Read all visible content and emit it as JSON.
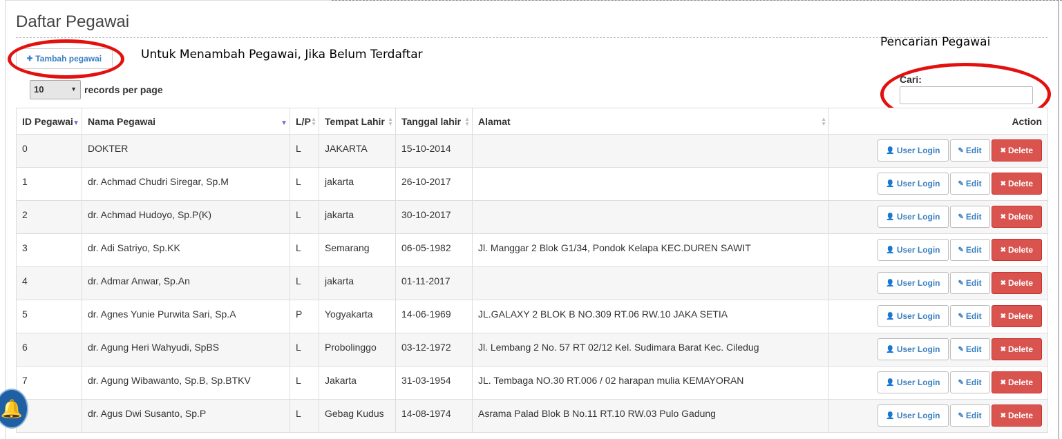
{
  "page": {
    "title": "Daftar Pegawai"
  },
  "toolbar": {
    "add_label": "Tambah pegawai",
    "add_icon": "plus-icon"
  },
  "annotations": {
    "add_note": "Untuk Menambah Pegawai, Jika Belum Terdaftar",
    "search_note": "Pencarian Pegawai",
    "highlight_color": "#e3110e"
  },
  "length_menu": {
    "value": "10",
    "label": "records per page"
  },
  "search": {
    "label": "Cari:",
    "value": ""
  },
  "table": {
    "headers": [
      "ID Pegawai",
      "Nama Pegawai",
      "L/P",
      "Tempat Lahir",
      "Tanggal lahir",
      "Alamat",
      "Action"
    ],
    "sorted_column": "Nama Pegawai",
    "rows": [
      {
        "id": "0",
        "name": "DOKTER",
        "gender": "L",
        "birthplace": "JAKARTA",
        "birthdate": "15-10-2014",
        "address": ""
      },
      {
        "id": "1",
        "name": "dr. Achmad Chudri Siregar, Sp.M",
        "gender": "L",
        "birthplace": "jakarta",
        "birthdate": "26-10-2017",
        "address": ""
      },
      {
        "id": "2",
        "name": "dr. Achmad Hudoyo, Sp.P(K)",
        "gender": "L",
        "birthplace": "jakarta",
        "birthdate": "30-10-2017",
        "address": ""
      },
      {
        "id": "3",
        "name": "dr. Adi Satriyo, Sp.KK",
        "gender": "L",
        "birthplace": "Semarang",
        "birthdate": "06-05-1982",
        "address": "Jl. Manggar 2 Blok G1/34, Pondok Kelapa KEC.DUREN SAWIT"
      },
      {
        "id": "4",
        "name": "dr. Admar Anwar, Sp.An",
        "gender": "L",
        "birthplace": "jakarta",
        "birthdate": "01-11-2017",
        "address": ""
      },
      {
        "id": "5",
        "name": "dr. Agnes Yunie Purwita Sari, Sp.A",
        "gender": "P",
        "birthplace": "Yogyakarta",
        "birthdate": "14-06-1969",
        "address": "JL.GALAXY 2 BLOK B NO.309 RT.06 RW.10 JAKA SETIA"
      },
      {
        "id": "6",
        "name": "dr. Agung Heri Wahyudi, SpBS",
        "gender": "L",
        "birthplace": "Probolinggo",
        "birthdate": "03-12-1972",
        "address": "Jl. Lembang 2 No. 57 RT 02/12 Kel. Sudimara Barat Kec. Ciledug"
      },
      {
        "id": "7",
        "name": "dr. Agung Wibawanto, Sp.B, Sp.BTKV",
        "gender": "L",
        "birthplace": "Jakarta",
        "birthdate": "31-03-1954",
        "address": "JL. Tembaga NO.30 RT.006 / 02 harapan mulia KEMAYORAN"
      },
      {
        "id": "",
        "name": "dr. Agus Dwi Susanto, Sp.P",
        "gender": "L",
        "birthplace": "Gebag Kudus",
        "birthdate": "14-08-1974",
        "address": "Asrama Palad Blok B No.11 RT.10 RW.03 Pulo Gadung"
      }
    ],
    "actions": {
      "login": "User Login",
      "edit": "Edit",
      "delete": "Delete"
    }
  },
  "colors": {
    "link": "#3a7fc1",
    "danger": "#d9534f",
    "stripe": "#f6f6f6"
  }
}
